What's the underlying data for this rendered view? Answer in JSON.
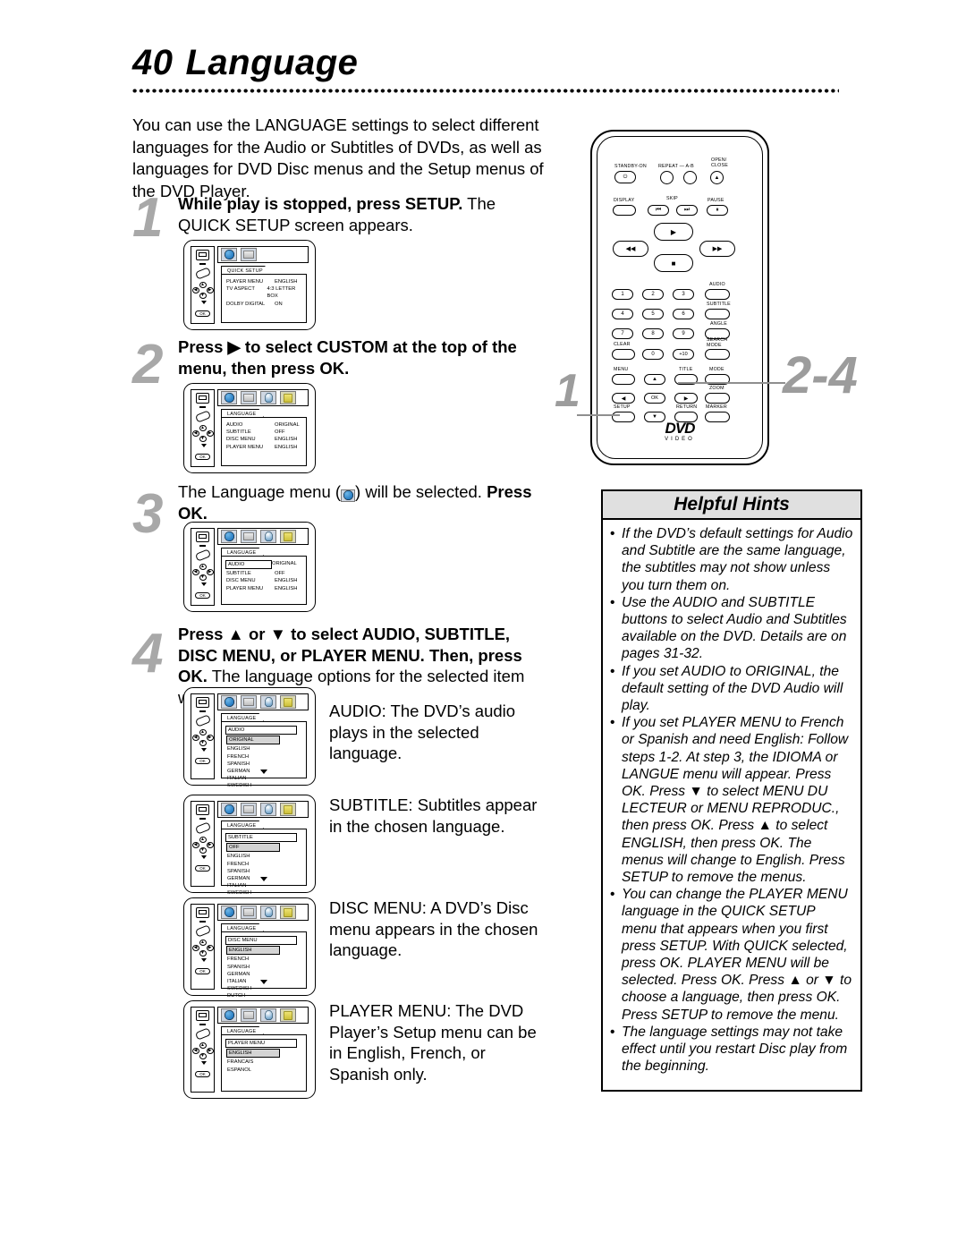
{
  "page": {
    "number": "40",
    "title": "Language",
    "intro": "You can use the LANGUAGE settings to select different languages for the Audio or Subtitles of DVDs, as well as languages for DVD Disc menus and the Setup menus of the DVD Player."
  },
  "steps": [
    {
      "num": "1",
      "bold": "While play is stopped, press SETUP.",
      "rest": " The QUICK SETUP screen appears."
    },
    {
      "num": "2",
      "bold_pre": "Press ",
      "arrow": "▶",
      "bold_post": " to select CUSTOM at the top of the menu, then press OK.",
      "rest": ""
    },
    {
      "num": "3",
      "pre": "The Language menu (",
      "post": ") will be selected. ",
      "bold_tail": "Press OK."
    },
    {
      "num": "4",
      "bold_pre": "Press ",
      "up": "▲",
      "mid": " or ",
      "down": "▼",
      "bold_post": " to select AUDIO, SUBTITLE, DISC MENU, or PLAYER MENU. Then, press OK.",
      "rest": " The language options for the selected item will appear."
    }
  ],
  "screens": {
    "quick_setup": {
      "tab": "QUICK SETUP",
      "rows": [
        {
          "label": "PLAYER MENU",
          "value": "ENGLISH"
        },
        {
          "label": "TV ASPECT",
          "value": "4:3 LETTER BOX"
        },
        {
          "label": "DOLBY DIGITAL",
          "value": "ON"
        }
      ]
    },
    "language_menu": {
      "tab": "LANGUAGE",
      "rows": [
        {
          "label": "AUDIO",
          "value": "ORIGINAL"
        },
        {
          "label": "SUBTITLE",
          "value": "OFF"
        },
        {
          "label": "DISC MENU",
          "value": "ENGLISH"
        },
        {
          "label": "PLAYER MENU",
          "value": "ENGLISH"
        }
      ]
    },
    "audio_list": {
      "tab": "LANGUAGE",
      "heading": "AUDIO",
      "selected": "ORIGINAL",
      "options": [
        "ENGLISH",
        "FRENCH",
        "SPANISH",
        "GERMAN",
        "ITALIAN",
        "SWEDISH"
      ]
    },
    "subtitle_list": {
      "tab": "LANGUAGE",
      "heading": "SUBTITLE",
      "selected": "OFF",
      "options": [
        "ENGLISH",
        "FRENCH",
        "SPANISH",
        "GERMAN",
        "ITALIAN",
        "SWEDISH"
      ]
    },
    "disc_menu_list": {
      "tab": "LANGUAGE",
      "heading": "DISC MENU",
      "selected": "ENGLISH",
      "options": [
        "FRENCH",
        "SPANISH",
        "GERMAN",
        "ITALIAN",
        "SWEDISH",
        "DUTCH"
      ]
    },
    "player_menu_list": {
      "tab": "LANGUAGE",
      "heading": "PLAYER MENU",
      "selected": "ENGLISH",
      "options": [
        "FRANCAIS",
        "ESPANOL"
      ]
    },
    "icons": [
      "globe-icon",
      "tv-icon",
      "audio-icon",
      "lock-icon"
    ],
    "sidebar_icons": [
      "monitor-icon",
      "remote-icon",
      "dpad-icon",
      "ok-icon"
    ],
    "ok_label": "OK"
  },
  "captions": {
    "audio": "AUDIO: The DVD’s audio plays in the selected language.",
    "subtitle": "SUBTITLE: Subtitles appear in the chosen language.",
    "disc_menu": "DISC MENU: A DVD’s Disc menu appears in the chosen language.",
    "player_menu": "PLAYER MENU: The DVD Player’s Setup menu can be in English, French, or Spanish only."
  },
  "remote": {
    "labels": {
      "standby": "STANDBY-ON",
      "repeat": "REPEAT — A-B",
      "open_close": "OPEN/\nCLOSE",
      "display": "DISPLAY",
      "skip": "SKIP",
      "pause": "PAUSE",
      "audio": "AUDIO",
      "subtitle": "SUBTITLE",
      "angle": "ANGLE",
      "search_mode": "SEARCH\nMODE",
      "clear": "CLEAR",
      "menu": "MENU",
      "title": "TITLE",
      "mode": "MODE",
      "zoom": "ZOOM",
      "setup": "SETUP",
      "return": "RETURN",
      "marker": "MARKER"
    },
    "keys": {
      "power": "⏻",
      "eject": "▲",
      "skip_prev": "⏮",
      "skip_next": "⏭",
      "pause": "⏸",
      "play": "▶",
      "stop": "■",
      "rew": "◀◀",
      "ff": "▶▶",
      "ok": "OK",
      "up": "▲",
      "down": "▼",
      "left": "◀",
      "right": "▶",
      "plus10": "+10"
    },
    "numbers": [
      "1",
      "2",
      "3",
      "4",
      "5",
      "6",
      "7",
      "8",
      "9",
      "0"
    ],
    "logo_top": "DVD",
    "logo_bottom": "VIDEO",
    "callout_1": "1",
    "callout_2": "2-4"
  },
  "hints": {
    "title": "Helpful Hints",
    "bullet": "•",
    "items": [
      "If the DVD’s default settings for Audio and Subtitle are the same language, the subtitles may not show unless you turn them on.",
      "Use the AUDIO and SUBTITLE buttons to select Audio and Subtitles available on the DVD. Details are on pages 31-32.",
      "If you set AUDIO to ORIGINAL, the default setting of the DVD Audio will play.",
      "If you set PLAYER MENU to French or Spanish and need English: Follow steps 1-2. At step 3, the IDIOMA or LANGUE menu will appear. Press OK. Press ▼ to select MENU DU LECTEUR or MENU REPRODUC., then press OK. Press ▲ to select ENGLISH, then press OK. The menus will change to English. Press SETUP to remove the menus.",
      "You can change the PLAYER MENU language in the QUICK SETUP menu that appears when you first press SETUP. With QUICK selected, press OK. PLAYER MENU will be selected. Press OK. Press ▲ or ▼ to choose a language, then press OK. Press SETUP to remove the menu.",
      "The language settings may not take effect until you restart Disc play from the beginning."
    ]
  }
}
